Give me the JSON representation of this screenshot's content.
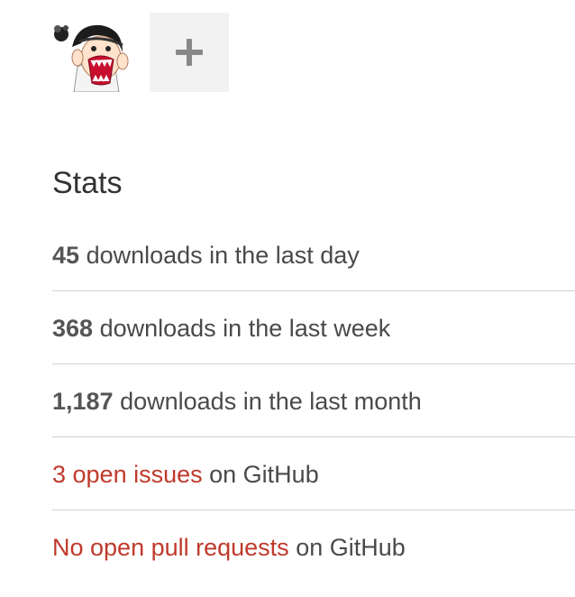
{
  "collaborators": {
    "add_label": "+"
  },
  "stats": {
    "title": "Stats",
    "downloads": [
      {
        "count": "45",
        "label": "downloads in the last day"
      },
      {
        "count": "368",
        "label": "downloads in the last week"
      },
      {
        "count": "1,187",
        "label": "downloads in the last month"
      }
    ],
    "issues": {
      "link_text": "3 open issues",
      "suffix": "on GitHub"
    },
    "pull_requests": {
      "link_text": "No open pull requests",
      "suffix": "on GitHub"
    }
  },
  "colors": {
    "link": "#c0392b",
    "text": "#4a4a4a",
    "divider": "#d0d0d0",
    "tile_bg": "#f2f2f2"
  }
}
